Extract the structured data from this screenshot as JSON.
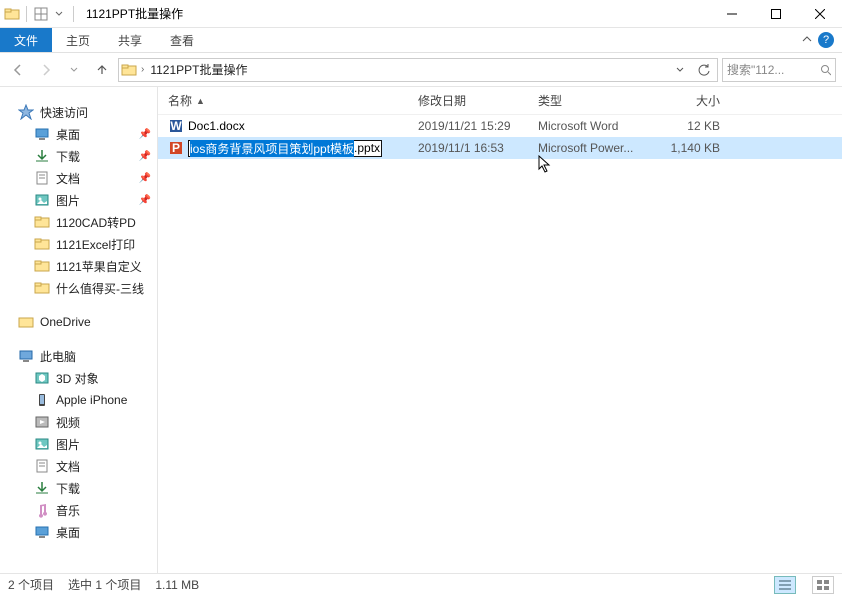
{
  "window": {
    "title": "1121PPT批量操作"
  },
  "ribbon": {
    "file": "文件",
    "tabs": [
      "主页",
      "共享",
      "查看"
    ]
  },
  "breadcrumb": {
    "items": [
      "1121PPT批量操作"
    ]
  },
  "search": {
    "placeholder": "搜索\"112..."
  },
  "nav": {
    "quick": "快速访问",
    "quick_items": [
      {
        "label": "桌面",
        "pinned": true,
        "icon": "desktop"
      },
      {
        "label": "下载",
        "pinned": true,
        "icon": "downloads"
      },
      {
        "label": "文档",
        "pinned": true,
        "icon": "documents"
      },
      {
        "label": "图片",
        "pinned": true,
        "icon": "pictures"
      },
      {
        "label": "1120CAD转PD",
        "pinned": false,
        "icon": "folder"
      },
      {
        "label": "1121Excel打印",
        "pinned": false,
        "icon": "folder"
      },
      {
        "label": "1121苹果自定义",
        "pinned": false,
        "icon": "folder"
      },
      {
        "label": "什么值得买-三线",
        "pinned": false,
        "icon": "folder"
      }
    ],
    "onedrive": "OneDrive",
    "thispc": "此电脑",
    "pc_items": [
      {
        "label": "3D 对象",
        "icon": "3d"
      },
      {
        "label": "Apple iPhone",
        "icon": "phone"
      },
      {
        "label": "视频",
        "icon": "videos"
      },
      {
        "label": "图片",
        "icon": "pictures"
      },
      {
        "label": "文档",
        "icon": "documents"
      },
      {
        "label": "下载",
        "icon": "downloads"
      },
      {
        "label": "音乐",
        "icon": "music"
      },
      {
        "label": "桌面",
        "icon": "desktop"
      }
    ]
  },
  "columns": {
    "name": "名称",
    "date": "修改日期",
    "type": "类型",
    "size": "大小"
  },
  "files": [
    {
      "icon": "word",
      "name": "Doc1.docx",
      "date": "2019/11/21 15:29",
      "type": "Microsoft Word",
      "size": "12 KB",
      "selected": false,
      "renaming": false
    },
    {
      "icon": "ppt",
      "name_sel": "ios商务背景风项目策划ppt模板",
      "name_ext": ".pptx",
      "date": "2019/11/1 16:53",
      "type": "Microsoft Power...",
      "size": "1,140 KB",
      "selected": true,
      "renaming": true
    }
  ],
  "status": {
    "count": "2 个项目",
    "selected": "选中 1 个项目",
    "size": "1.11 MB"
  }
}
